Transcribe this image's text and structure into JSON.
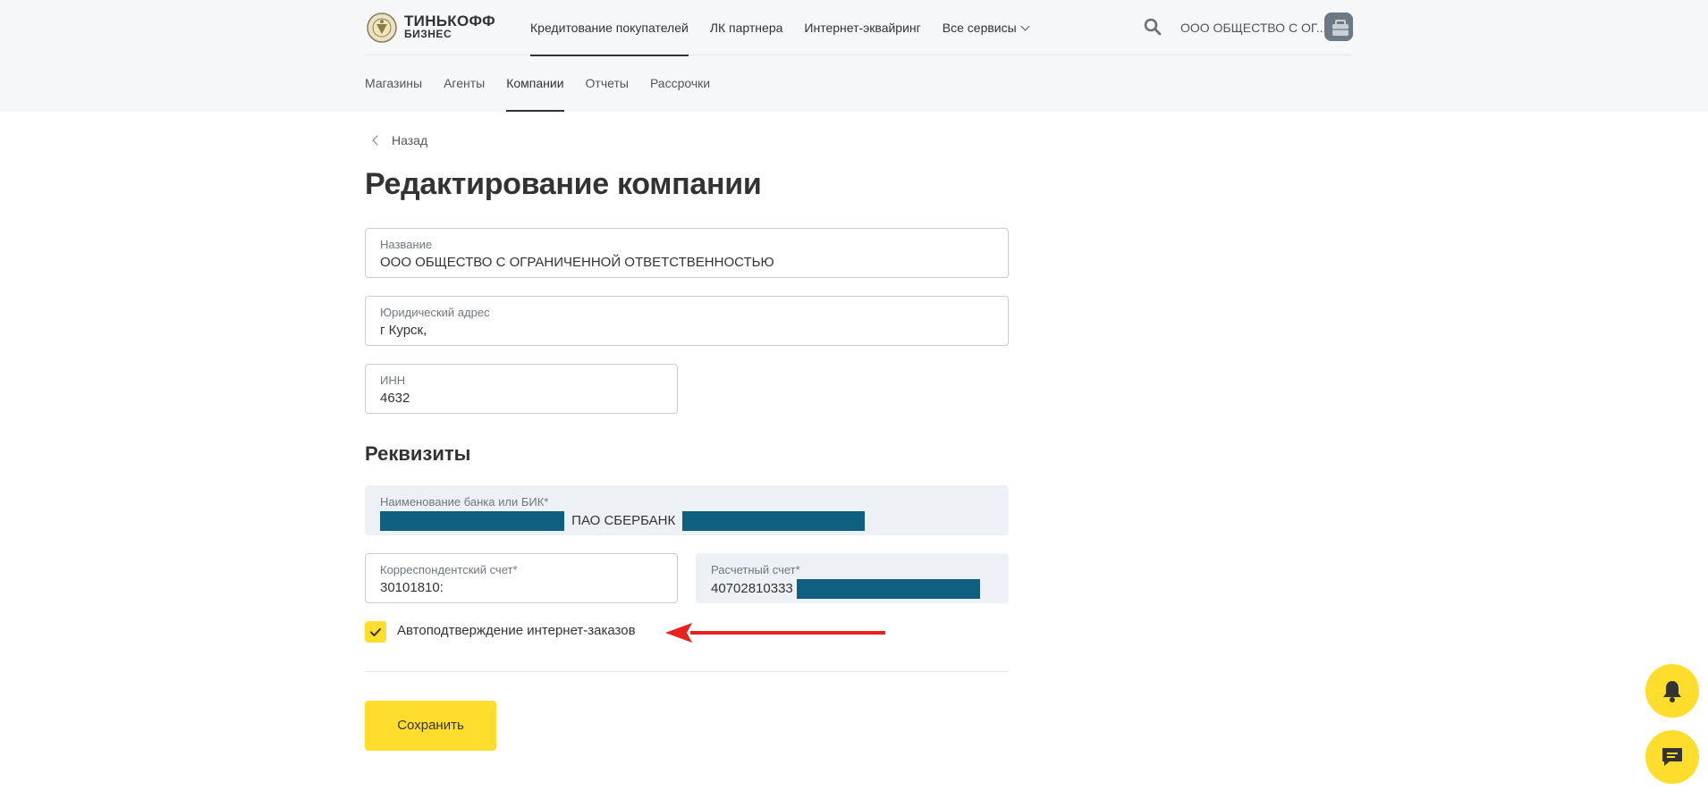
{
  "header": {
    "logo_main": "ТИНЬКОФФ",
    "logo_sub": "БИЗНЕС",
    "top_nav": [
      {
        "label": "Кредитование покупателей",
        "active": true
      },
      {
        "label": "ЛК партнера",
        "active": false
      },
      {
        "label": "Интернет-эквайринг",
        "active": false
      },
      {
        "label": "Все сервисы",
        "active": false,
        "has_dropdown": true
      }
    ],
    "org_name": "ООО ОБЩЕСТВО С ОГ...",
    "sub_nav": [
      {
        "label": "Магазины",
        "active": false
      },
      {
        "label": "Агенты",
        "active": false
      },
      {
        "label": "Компании",
        "active": true
      },
      {
        "label": "Отчеты",
        "active": false
      },
      {
        "label": "Рассрочки",
        "active": false
      }
    ]
  },
  "main": {
    "back_label": "Назад",
    "title": "Редактирование компании",
    "fields": {
      "name": {
        "label": "Название",
        "value": "ООО ОБЩЕСТВО С ОГРАНИЧЕННОЙ ОТВЕТСТВЕННОСТЬЮ"
      },
      "address": {
        "label": "Юридический адрес",
        "value": "г Курск,"
      },
      "inn": {
        "label": "ИНН",
        "value": "4632"
      }
    },
    "requisites_title": "Реквизиты",
    "requisites": {
      "bank": {
        "label": "Наименование банка или БИК*",
        "value": "ПАО СБЕРБАНК"
      },
      "corr_account": {
        "label": "Корреспондентский счет*",
        "value": "30101810:"
      },
      "settlement_account": {
        "label": "Расчетный счет*",
        "value": "40702810333"
      }
    },
    "auto_confirm": {
      "label": "Автоподтверждение интернет-заказов",
      "checked": true
    },
    "save_label": "Сохранить"
  },
  "colors": {
    "accent_yellow": "#ffdd2d",
    "redaction": "#0f5f80",
    "annotation_arrow": "#e8231f"
  },
  "icons": [
    "search-icon",
    "chevron-down-icon",
    "back-chevron-icon",
    "checkmark-icon",
    "bell-icon",
    "chat-icon"
  ]
}
